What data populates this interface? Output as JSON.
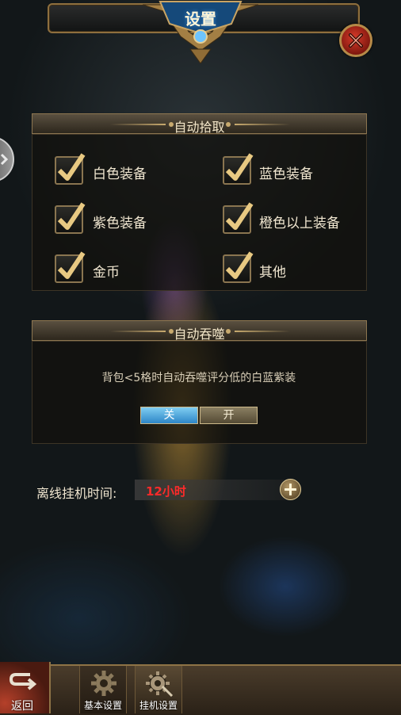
{
  "header": {
    "title": "设置"
  },
  "auto_pickup": {
    "title": "自动拾取",
    "items": [
      {
        "label": "白色装备",
        "checked": true
      },
      {
        "label": "蓝色装备",
        "checked": true
      },
      {
        "label": "紫色装备",
        "checked": true
      },
      {
        "label": "橙色以上装备",
        "checked": true
      },
      {
        "label": "金币",
        "checked": true
      },
      {
        "label": "其他",
        "checked": true
      }
    ]
  },
  "auto_devour": {
    "title": "自动吞噬",
    "description": "背包<5格时自动吞噬评分低的白蓝紫装",
    "off_label": "关",
    "on_label": "开",
    "selected": "关"
  },
  "offline": {
    "label": "离线挂机时间:",
    "value": "12小时"
  },
  "bottom": {
    "back_label": "返回",
    "tabs": [
      {
        "label": "基本设置"
      },
      {
        "label": "挂机设置"
      }
    ]
  },
  "colors": {
    "gold_border": "#8e6f3e",
    "toggle_active": "#2e86c7",
    "value_red": "#ff2a2a"
  }
}
